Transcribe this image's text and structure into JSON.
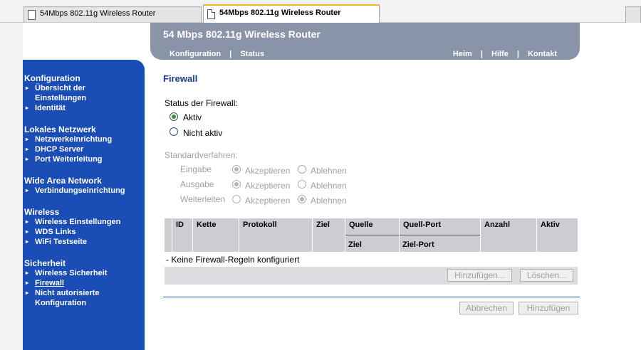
{
  "browser": {
    "tabs": [
      {
        "label": "54Mbps 802.11g Wireless Router",
        "active": false
      },
      {
        "label": "54Mbps 802.11g Wireless Router",
        "active": true
      }
    ]
  },
  "header": {
    "title": "54 Mbps 802.11g Wireless Router",
    "nav_left": [
      "Konfiguration",
      "Status"
    ],
    "nav_right": [
      "Heim",
      "Hilfe",
      "Kontakt"
    ],
    "separator": "|"
  },
  "sidebar": {
    "sections": [
      {
        "title": "Konfiguration",
        "items": [
          [
            "Übersicht der",
            "Einstellungen"
          ],
          [
            "Identität"
          ]
        ]
      },
      {
        "title": "Lokales Netzwerk",
        "items": [
          [
            "Netzwerkeinrichtung"
          ],
          [
            "DHCP Server"
          ],
          [
            "Port Weiterleitung"
          ]
        ]
      },
      {
        "title": "Wide Area Network",
        "items": [
          [
            "Verbindungseinrichtung"
          ]
        ]
      },
      {
        "title": "Wireless",
        "items": [
          [
            "Wireless Einstellungen"
          ],
          [
            "WDS Links"
          ],
          [
            "WiFi Testseite"
          ]
        ]
      },
      {
        "title": "Sicherheit",
        "items": [
          [
            "Wireless Sicherheit"
          ],
          [
            "Firewall"
          ],
          [
            "Nicht autorisierte",
            "Konfiguration"
          ]
        ]
      }
    ],
    "current": "Firewall"
  },
  "firewall": {
    "title": "Firewall",
    "status_label": "Status der Firewall:",
    "status_options": [
      "Aktiv",
      "Nicht aktiv"
    ],
    "status_selected": "Aktiv",
    "policy_label": "Standardverfahren:",
    "policy_rows": [
      {
        "label": "Eingabe",
        "accept": "Akzeptieren",
        "reject": "Ablehnen",
        "selected": "accept"
      },
      {
        "label": "Ausgabe",
        "accept": "Akzeptieren",
        "reject": "Ablehnen",
        "selected": "accept"
      },
      {
        "label": "Weiterleiten",
        "accept": "Akzeptieren",
        "reject": "Ablehnen",
        "selected": "reject"
      }
    ],
    "table": {
      "columns": [
        "ID",
        "Kette",
        "Protokoll",
        "Ziel",
        "Quelle",
        "Quell-Port",
        "Anzahl",
        "Aktiv"
      ],
      "subcolumns": {
        "Quelle": "Ziel",
        "Quell-Port": "Ziel-Port"
      },
      "empty_text": "- Keine Firewall-Regeln konfiguriert",
      "add_button": "Hinzufügen...",
      "delete_button": "Löschen..."
    },
    "cancel_button": "Abbrechen",
    "submit_button": "Hinzufügen"
  },
  "colors": {
    "sidebar_bg": "#1a4db5",
    "header_bg": "#8a94a8",
    "title_color": "#1a3d8f",
    "radio_checked": "#2e9a2e"
  }
}
